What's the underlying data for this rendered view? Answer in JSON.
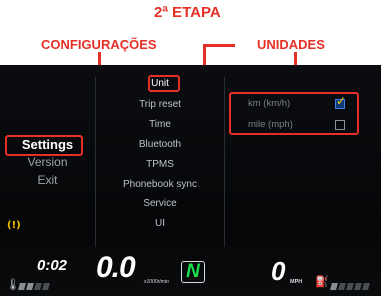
{
  "annotations": {
    "step": "2ª ETAPA",
    "configuracoes": "CONFIGURAÇÕES",
    "unidades": "UNIDADES"
  },
  "left_menu": [
    {
      "label": "Settings",
      "active": true
    },
    {
      "label": "Version",
      "active": false
    },
    {
      "label": "Exit",
      "active": false
    }
  ],
  "settings_menu": [
    {
      "label": "Unit",
      "active": true
    },
    {
      "label": "Trip reset",
      "active": false
    },
    {
      "label": "Time",
      "active": false
    },
    {
      "label": "Bluetooth",
      "active": false
    },
    {
      "label": "TPMS",
      "active": false
    },
    {
      "label": "Phonebook sync",
      "active": false
    },
    {
      "label": "Service",
      "active": false
    },
    {
      "label": "UI",
      "active": false
    }
  ],
  "unit_options": [
    {
      "label": "km (km/h)",
      "checked": true
    },
    {
      "label": "mile (mph)",
      "checked": false
    }
  ],
  "status": {
    "warning_icon": "warning-icon",
    "warning_glyph": "(!)",
    "time": "0:02",
    "temp_icon": "coolant-temperature-icon",
    "temp_level_bars": 4,
    "temp_level_on": 2,
    "speed": "0.0",
    "rpm_unit": "x1000r/min",
    "gear": "N",
    "mph_value": "0",
    "mph_unit": "MPH",
    "fuel_icon": "fuel-pump-icon",
    "fuel_level_bars": 5,
    "fuel_level_on": 1
  },
  "colors": {
    "annotation_red": "#e53027",
    "gear_green": "#19e04a",
    "check_yellow": "#ffd400",
    "checkbox_blue": "#3d7ee0",
    "warning_yellow": "#f2c200"
  }
}
